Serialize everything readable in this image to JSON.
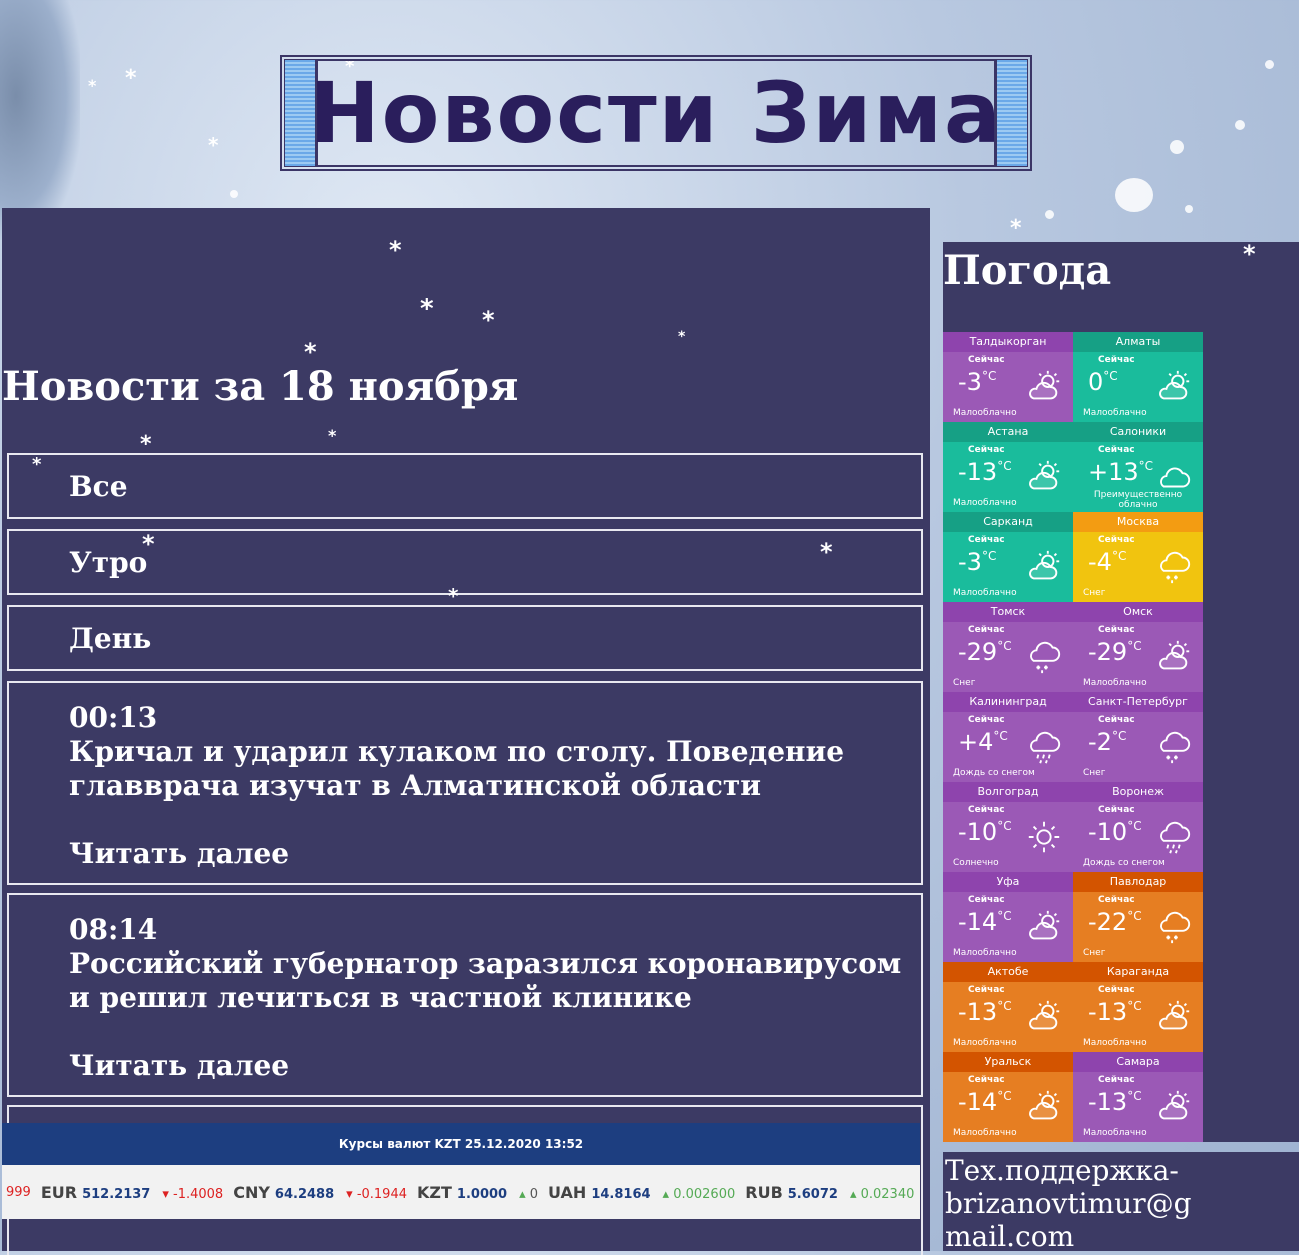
{
  "header": {
    "title": "Новости Зима"
  },
  "news": {
    "heading": "Новости за 18 ноября",
    "tabs": [
      {
        "label": "Все"
      },
      {
        "label": "Утро"
      },
      {
        "label": "День"
      }
    ],
    "articles": [
      {
        "time": "00:13",
        "title": "Кричал и ударил кулаком по столу. Поведение главврача изучат в Алматинской области",
        "more": "Читать далее"
      },
      {
        "time": "08:14",
        "title": "Российский губернатор заразился коронавирусом и решил лечиться в частной клинике",
        "more": "Читать далее"
      }
    ]
  },
  "currency": {
    "title": "Курсы валют KZT 25.12.2020 13:52",
    "lead_fragment": "999",
    "items": [
      {
        "code": "EUR",
        "rate": "512.2137",
        "change": "-1.4008",
        "dir": "down"
      },
      {
        "code": "CNY",
        "rate": "64.2488",
        "change": "-0.1944",
        "dir": "down"
      },
      {
        "code": "KZT",
        "rate": "1.0000",
        "change": "0",
        "dir": "flat"
      },
      {
        "code": "UAH",
        "rate": "14.8164",
        "change": "0.002600",
        "dir": "up"
      },
      {
        "code": "RUB",
        "rate": "5.6072",
        "change": "0.02340",
        "dir": "up"
      }
    ]
  },
  "weather": {
    "title": "Погода",
    "now_label": "Сейчас",
    "unit": "°C",
    "cities": [
      {
        "city": "Талдыкорган",
        "temp": "-3",
        "desc": "Малооблачно",
        "icon": "partly-cloudy-icon",
        "color": "#9b59b6",
        "head": "#8e44ad"
      },
      {
        "city": "Алматы",
        "temp": "0",
        "desc": "Малооблачно",
        "icon": "partly-cloudy-icon",
        "color": "#1abc9c",
        "head": "#16a085"
      },
      {
        "city": "Астана",
        "temp": "-13",
        "desc": "Малооблачно",
        "icon": "partly-cloudy-icon",
        "color": "#1abc9c",
        "head": "#16a085"
      },
      {
        "city": "Салоники",
        "temp": "+13",
        "desc": "Преимущественно облачно",
        "icon": "cloudy-icon",
        "color": "#1abc9c",
        "head": "#16a085"
      },
      {
        "city": "Сарканд",
        "temp": "-3",
        "desc": "Малооблачно",
        "icon": "partly-cloudy-icon",
        "color": "#1abc9c",
        "head": "#16a085"
      },
      {
        "city": "Москва",
        "temp": "-4",
        "desc": "Снег",
        "icon": "snow-icon",
        "color": "#f1c40f",
        "head": "#f39c12"
      },
      {
        "city": "Томск",
        "temp": "-29",
        "desc": "Снег",
        "icon": "snow-icon",
        "color": "#9b59b6",
        "head": "#8e44ad"
      },
      {
        "city": "Омск",
        "temp": "-29",
        "desc": "Малооблачно",
        "icon": "partly-cloudy-icon",
        "color": "#9b59b6",
        "head": "#8e44ad"
      },
      {
        "city": "Калининград",
        "temp": "+4",
        "desc": "Дождь со снегом",
        "icon": "sleet-icon",
        "color": "#9b59b6",
        "head": "#8e44ad"
      },
      {
        "city": "Санкт-Петербург",
        "temp": "-2",
        "desc": "Снег",
        "icon": "snow-icon",
        "color": "#9b59b6",
        "head": "#8e44ad"
      },
      {
        "city": "Волгоград",
        "temp": "-10",
        "desc": "Солнечно",
        "icon": "sun-icon",
        "color": "#9b59b6",
        "head": "#8e44ad"
      },
      {
        "city": "Воронеж",
        "temp": "-10",
        "desc": "Дождь со снегом",
        "icon": "sleet-icon",
        "color": "#9b59b6",
        "head": "#8e44ad"
      },
      {
        "city": "Уфа",
        "temp": "-14",
        "desc": "Малооблачно",
        "icon": "partly-cloudy-icon",
        "color": "#9b59b6",
        "head": "#8e44ad"
      },
      {
        "city": "Павлодар",
        "temp": "-22",
        "desc": "Снег",
        "icon": "snow-icon",
        "color": "#e67e22",
        "head": "#d35400"
      },
      {
        "city": "Актобе",
        "temp": "-13",
        "desc": "Малооблачно",
        "icon": "partly-cloudy-icon",
        "color": "#e67e22",
        "head": "#d35400"
      },
      {
        "city": "Караганда",
        "temp": "-13",
        "desc": "Малооблачно",
        "icon": "partly-cloudy-icon",
        "color": "#e67e22",
        "head": "#d35400"
      },
      {
        "city": "Уральск",
        "temp": "-14",
        "desc": "Малооблачно",
        "icon": "partly-cloudy-icon",
        "color": "#e67e22",
        "head": "#d35400"
      },
      {
        "city": "Самара",
        "temp": "-13",
        "desc": "Малооблачно",
        "icon": "partly-cloudy-icon",
        "color": "#9b59b6",
        "head": "#8e44ad"
      }
    ]
  },
  "support": {
    "text": "Тех.поддержка-brizanovtimur@g mail.com"
  }
}
